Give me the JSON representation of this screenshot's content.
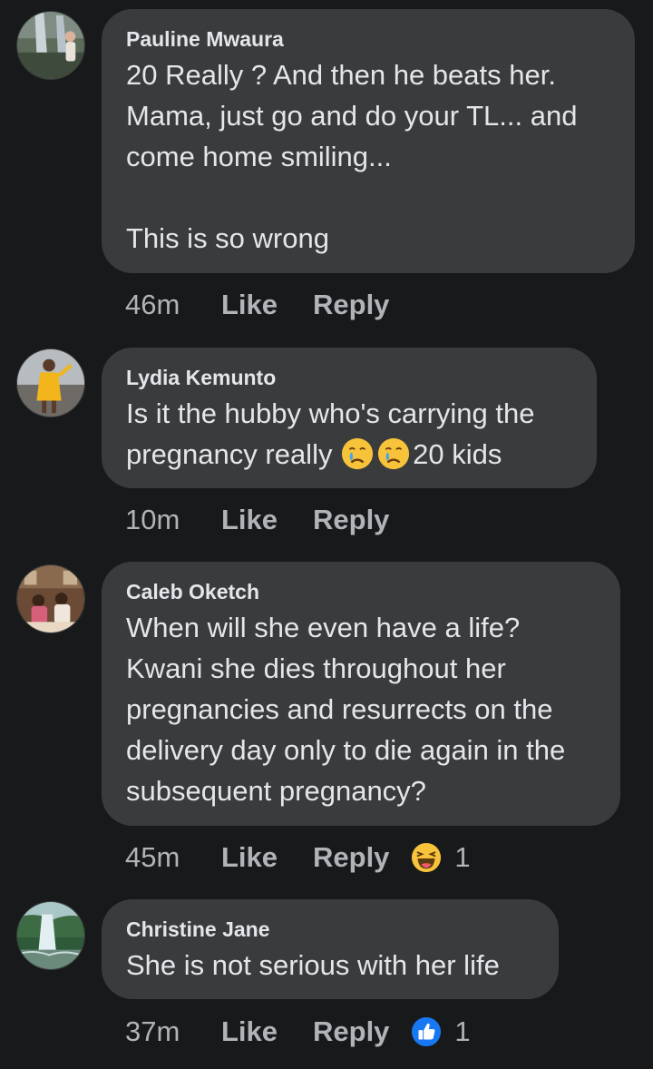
{
  "comments": [
    {
      "author": "Pauline Mwaura",
      "line1": "20 Really ? And then he beats her.",
      "line2": "Mama, just go and do your TL... and",
      "line3": "come home smiling...",
      "line4": "",
      "line5": "This is so wrong",
      "time": "46m",
      "like_label": "Like",
      "reply_label": "Reply",
      "avatar_icon": "profile-photo-waterfall-person"
    },
    {
      "author": "Lydia Kemunto",
      "line1": "Is it the hubby who's carrying the",
      "line2_prefix": "pregnancy really",
      "line2_suffix": "20 kids",
      "emoji": "crying-face-emoji",
      "time": "10m",
      "like_label": "Like",
      "reply_label": "Reply",
      "avatar_icon": "profile-photo-yellow-dress"
    },
    {
      "author": "Caleb Oketch",
      "line1": "When will she even have a life?",
      "line2": "Kwani she dies throughout her",
      "line3": "pregnancies and resurrects on the",
      "line4": "delivery day only to die again in the",
      "line5": "subsequent pregnancy?",
      "time": "45m",
      "like_label": "Like",
      "reply_label": "Reply",
      "reaction_icon": "haha-reaction-icon",
      "reaction_count": "1",
      "avatar_icon": "profile-photo-group-indoor"
    },
    {
      "author": "Christine Jane",
      "line1": "She is not serious with her life",
      "time": "37m",
      "like_label": "Like",
      "reply_label": "Reply",
      "reaction_icon": "like-reaction-icon",
      "reaction_count": "1",
      "avatar_icon": "profile-photo-waterfall"
    }
  ],
  "colors": {
    "background": "#18191a",
    "bubble": "#3a3b3c",
    "text": "#e4e6eb",
    "secondary_text": "#b0b3b8",
    "like_blue": "#1877f2",
    "emoji_yellow": "#f7c33b"
  }
}
